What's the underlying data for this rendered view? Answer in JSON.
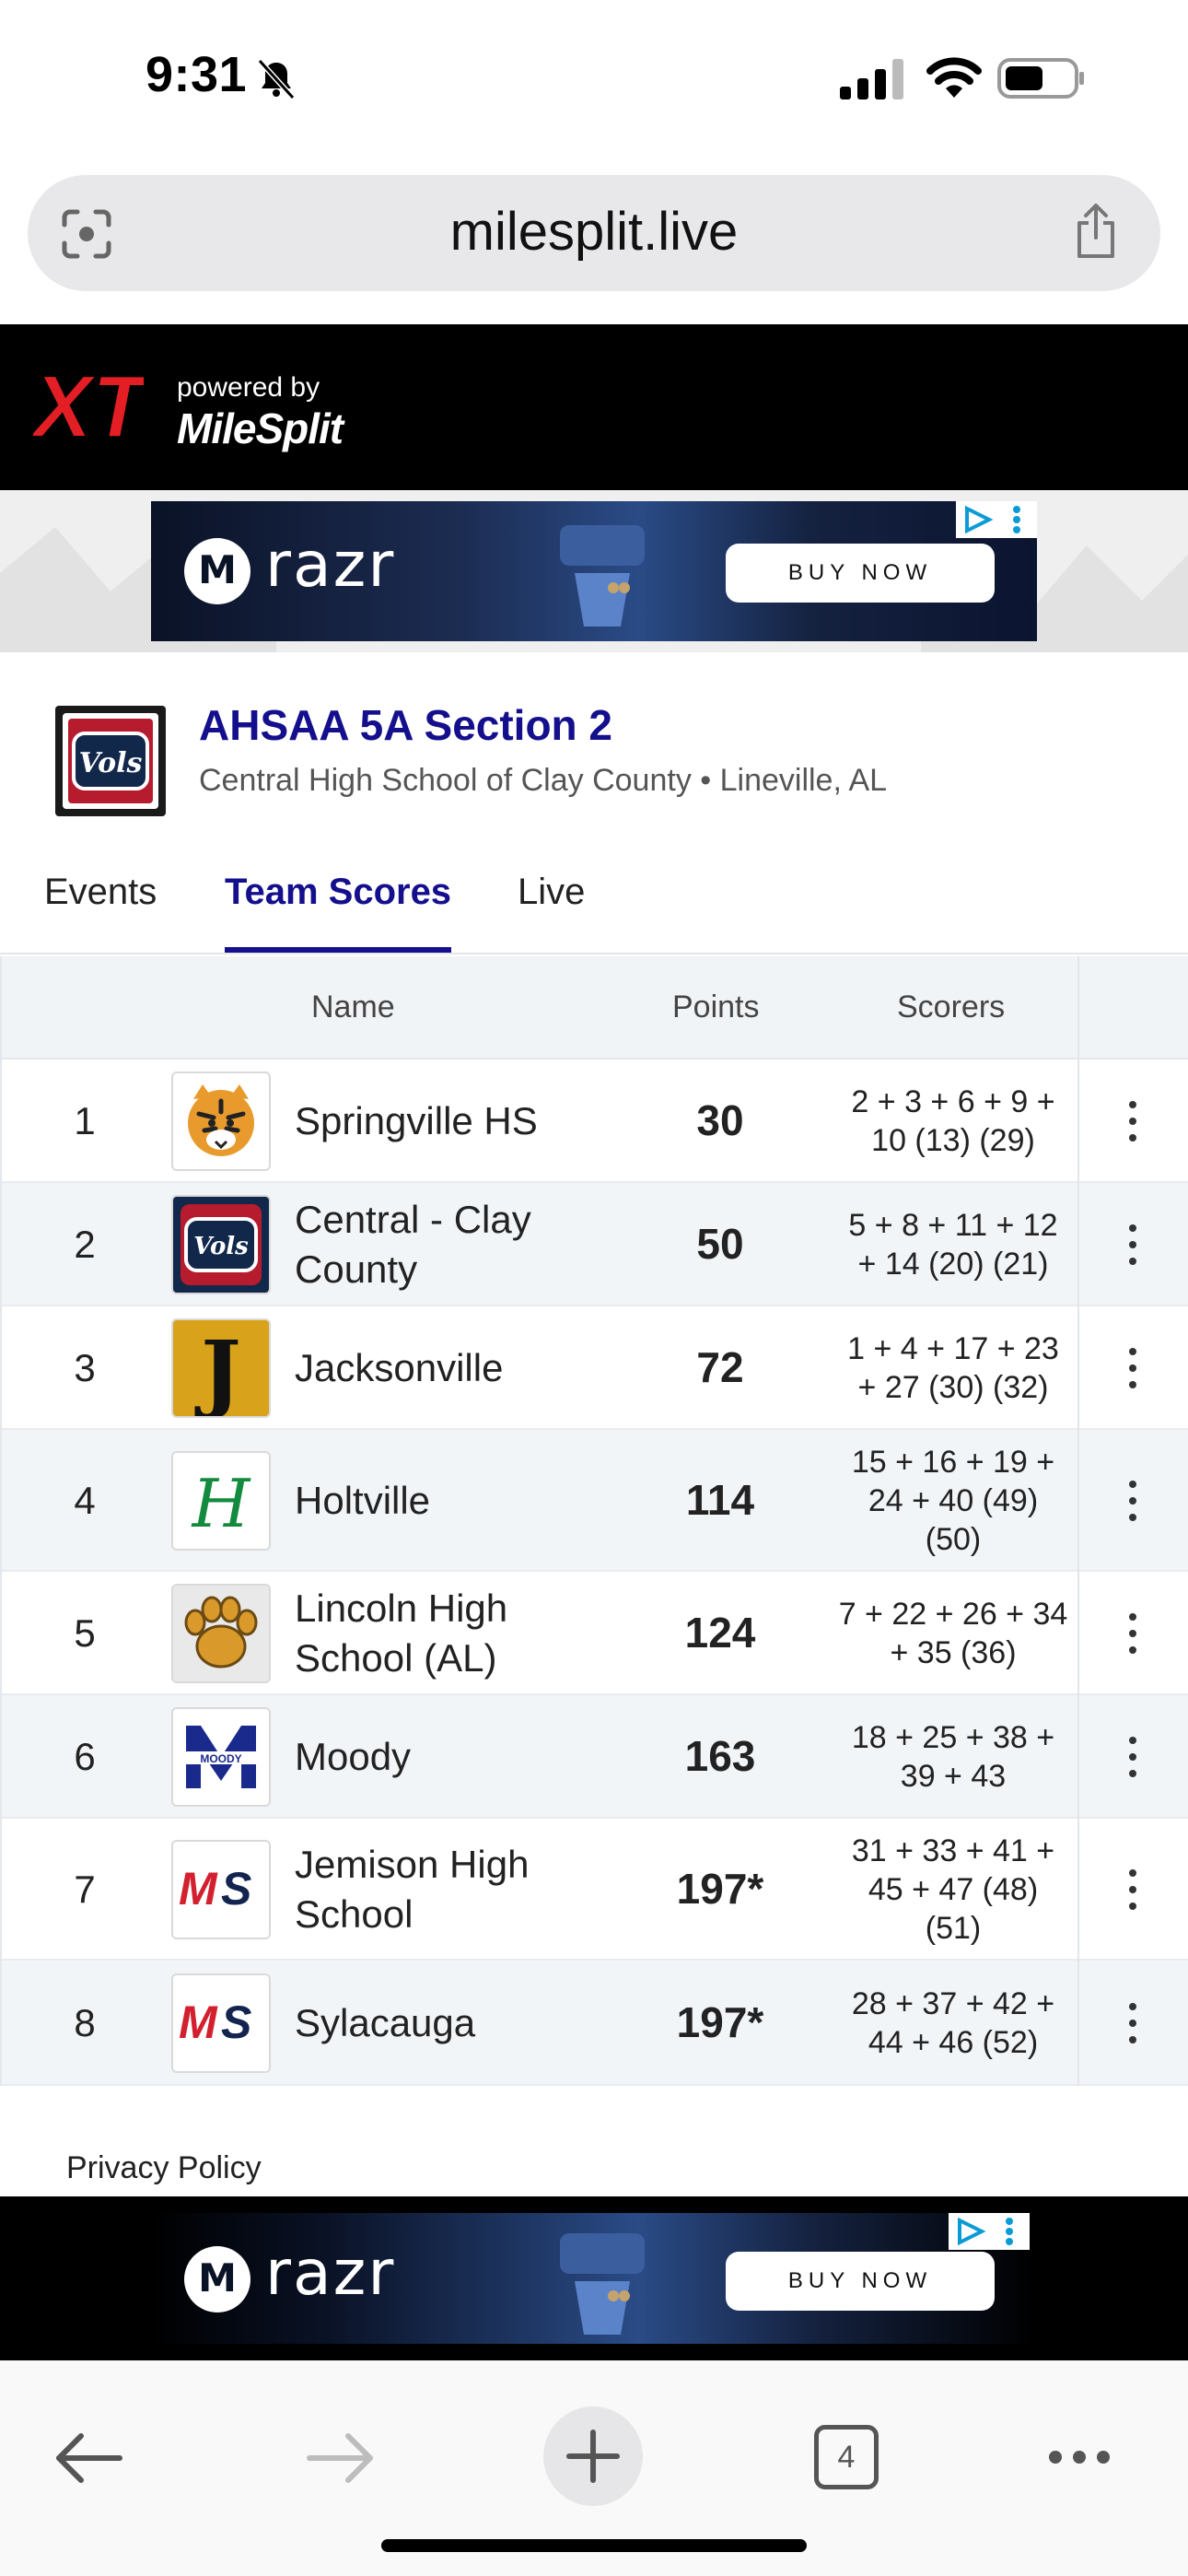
{
  "status_bar": {
    "time": "9:31"
  },
  "browser": {
    "url": "milesplit.live",
    "open_tabs": "4"
  },
  "site_header": {
    "logo": "XT",
    "powered_by": "powered by",
    "brand": "MileSplit"
  },
  "ad": {
    "brand": "razr",
    "cta": "BUY NOW"
  },
  "meet": {
    "title": "AHSAA 5A Section 2",
    "subtitle": "Central High School of Clay County • Lineville, AL",
    "logo_text": "Vols"
  },
  "tabs": [
    {
      "label": "Events"
    },
    {
      "label": "Team Scores",
      "active": true
    },
    {
      "label": "Live"
    }
  ],
  "table": {
    "headers": {
      "name": "Name",
      "points": "Points",
      "scorers": "Scorers"
    },
    "rows": [
      {
        "rank": "1",
        "name": [
          "Springville HS"
        ],
        "points": "30",
        "scorers": [
          "2 + 3 + 6 + 9 +",
          "10 (13) (29)"
        ],
        "logo": "tiger"
      },
      {
        "rank": "2",
        "name": [
          "Central - Clay",
          "County"
        ],
        "points": "50",
        "scorers": [
          "5 + 8 + 11 + 12",
          "+ 14 (20) (21)"
        ],
        "logo": "vols"
      },
      {
        "rank": "3",
        "name": [
          "Jacksonville"
        ],
        "points": "72",
        "scorers": [
          "1 + 4 + 17 + 23",
          "+ 27 (30) (32)"
        ],
        "logo": "gothic-j"
      },
      {
        "rank": "4",
        "name": [
          "Holtville"
        ],
        "points": "114",
        "scorers": [
          "15 + 16 + 19 +",
          "24 + 40 (49)",
          "(50)"
        ],
        "logo": "script-h"
      },
      {
        "rank": "5",
        "name": [
          "Lincoln High",
          "School (AL)"
        ],
        "points": "124",
        "scorers": [
          "7 + 22 + 26 + 34",
          "+ 35 (36)"
        ],
        "logo": "paw"
      },
      {
        "rank": "6",
        "name": [
          "Moody"
        ],
        "points": "163",
        "scorers": [
          "18 + 25 + 38 +",
          "39 + 43"
        ],
        "logo": "moody-m"
      },
      {
        "rank": "7",
        "name": [
          "Jemison High",
          "School"
        ],
        "points": "197*",
        "scorers": [
          "31 + 33 + 41 +",
          "45 + 47 (48)",
          "(51)"
        ],
        "logo": "ms"
      },
      {
        "rank": "8",
        "name": [
          "Sylacauga"
        ],
        "points": "197*",
        "scorers": [
          "28 + 37 + 42 +",
          "44 + 46 (52)"
        ],
        "logo": "ms"
      }
    ]
  },
  "footer": {
    "privacy": "Privacy Policy"
  },
  "colors": {
    "accent": "#140f8c",
    "header_bg": "#000000",
    "table_alt": "#f2f5f8"
  }
}
